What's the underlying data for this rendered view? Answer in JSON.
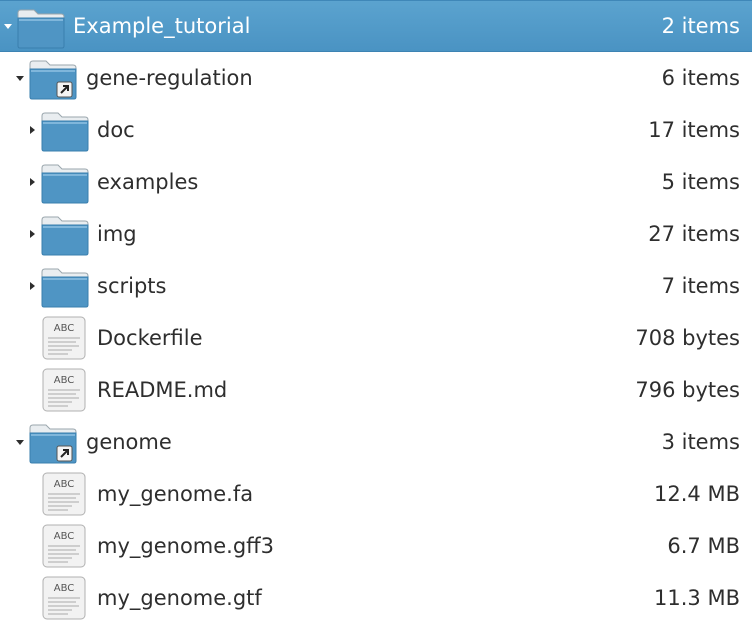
{
  "colors": {
    "selection": "#4d97c8",
    "text": "#2e2e2e",
    "selected_text": "#ffffff",
    "folder_body": "#4f95c4",
    "folder_tab": "#e9edf0"
  },
  "rows": [
    {
      "name": "Example_tutorial",
      "size": "2 items",
      "kind": "folder",
      "expander": "expanded",
      "selected": true
    },
    {
      "name": "gene-regulation",
      "size": "6 items",
      "kind": "folder-link",
      "expander": "expanded"
    },
    {
      "name": "doc",
      "size": "17 items",
      "kind": "folder",
      "expander": "collapsed"
    },
    {
      "name": "examples",
      "size": "5 items",
      "kind": "folder",
      "expander": "collapsed"
    },
    {
      "name": "img",
      "size": "27 items",
      "kind": "folder",
      "expander": "collapsed"
    },
    {
      "name": "scripts",
      "size": "7 items",
      "kind": "folder",
      "expander": "collapsed"
    },
    {
      "name": "Dockerfile",
      "size": "708 bytes",
      "kind": "text-file",
      "expander": "none"
    },
    {
      "name": "README.md",
      "size": "796 bytes",
      "kind": "text-file",
      "expander": "none"
    },
    {
      "name": "genome",
      "size": "3 items",
      "kind": "folder-link",
      "expander": "expanded"
    },
    {
      "name": "my_genome.fa",
      "size": "12.4 MB",
      "kind": "text-file",
      "expander": "none"
    },
    {
      "name": "my_genome.gff3",
      "size": "6.7 MB",
      "kind": "text-file",
      "expander": "none"
    },
    {
      "name": "my_genome.gtf",
      "size": "11.3 MB",
      "kind": "text-file",
      "expander": "none"
    }
  ],
  "file_icon_label": "ABC"
}
